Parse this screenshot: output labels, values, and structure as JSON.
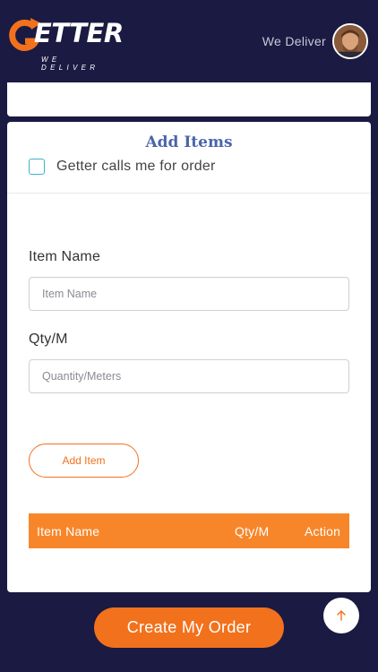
{
  "header": {
    "logo_word": "ETTER",
    "logo_sub": "WE DELIVER",
    "tagline": "We Deliver"
  },
  "card": {
    "title": "Add Items",
    "call_option_label": "Getter calls me for order",
    "call_option_checked": false,
    "item_name": {
      "label": "Item Name",
      "placeholder": "Item Name",
      "value": ""
    },
    "qty": {
      "label": "Qty/M",
      "placeholder": "Quantity/Meters",
      "value": ""
    },
    "add_item_label": "Add Item",
    "table_headers": [
      "Item Name",
      "Qty/M",
      "Action"
    ]
  },
  "footer": {
    "cta_label": "Create My Order",
    "scroll_top_icon": "arrow-up-icon"
  },
  "colors": {
    "background": "#1a1a42",
    "accent": "#f2711c",
    "table_header": "#f7862a",
    "title": "#4a66a8",
    "checkbox": "#3fb3c9"
  }
}
